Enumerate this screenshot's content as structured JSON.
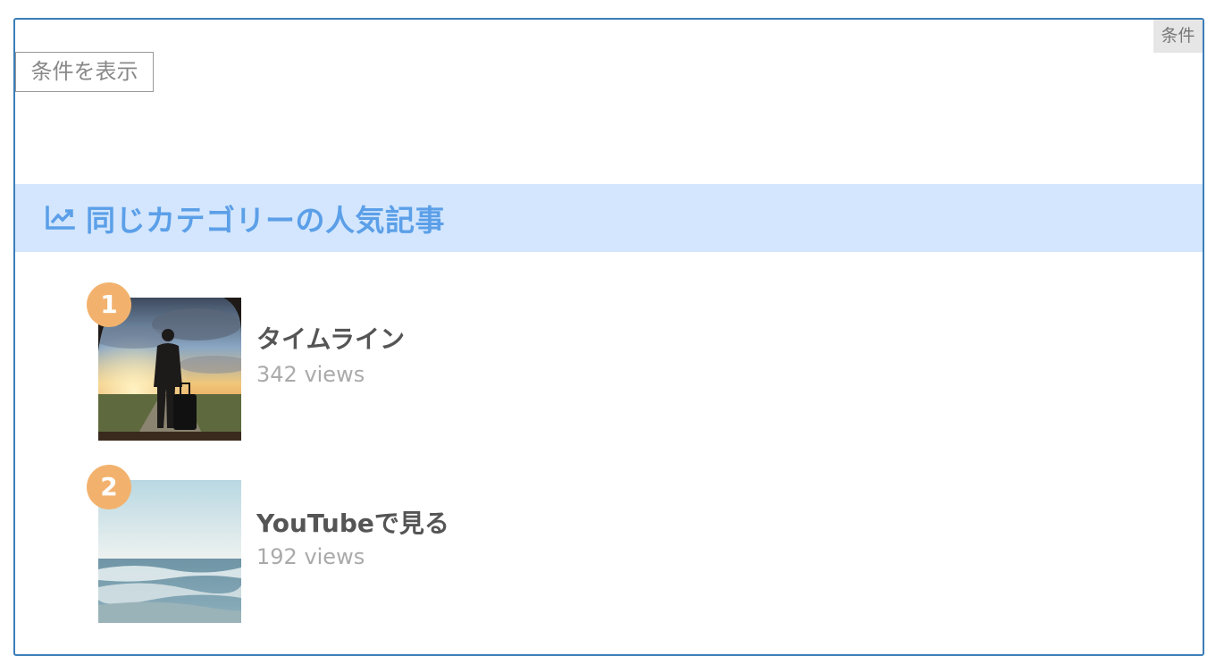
{
  "condition_tag": "条件",
  "show_conditions_button": "条件を表示",
  "popular": {
    "icon": "trend-up-icon",
    "title": "同じカテゴリーの人気記事",
    "items": [
      {
        "rank": "1",
        "title": "タイムライン",
        "views": "342 views",
        "thumbnail": "traveler-sunset-image"
      },
      {
        "rank": "2",
        "title": "YouTubeで見る",
        "views": "192 views",
        "thumbnail": "ocean-waves-image"
      }
    ]
  },
  "colors": {
    "frame_border": "#3b7db8",
    "header_bg": "#d3e6fd",
    "header_text": "#5b9fe8",
    "badge": "#f2b26e"
  }
}
